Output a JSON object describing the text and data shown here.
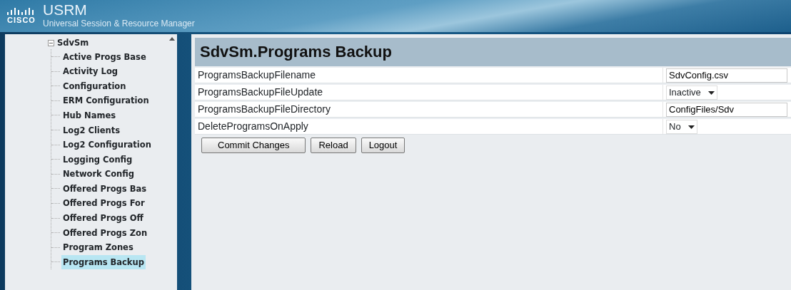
{
  "header": {
    "brand": "CISCO",
    "title": "USRM",
    "subtitle": "Universal Session & Resource Manager"
  },
  "sidebar": {
    "root": {
      "label": "SdvSm",
      "expanded": true,
      "children": [
        {
          "label": "Active Progs Base",
          "selected": false
        },
        {
          "label": "Activity Log",
          "selected": false
        },
        {
          "label": "Configuration",
          "selected": false
        },
        {
          "label": "ERM Configuration",
          "selected": false
        },
        {
          "label": "Hub Names",
          "selected": false
        },
        {
          "label": "Log2 Clients",
          "selected": false
        },
        {
          "label": "Log2 Configuration",
          "selected": false
        },
        {
          "label": "Logging Config",
          "selected": false
        },
        {
          "label": "Network Config",
          "selected": false
        },
        {
          "label": "Offered Progs Bas",
          "selected": false
        },
        {
          "label": "Offered Progs For",
          "selected": false
        },
        {
          "label": "Offered Progs Off",
          "selected": false
        },
        {
          "label": "Offered Progs Zon",
          "selected": false
        },
        {
          "label": "Program Zones",
          "selected": false
        },
        {
          "label": "Programs Backup",
          "selected": true
        }
      ]
    }
  },
  "panel": {
    "title": "SdvSm.Programs Backup",
    "fields": [
      {
        "label": "ProgramsBackupFilename",
        "kind": "text",
        "value": "SdvConfig.csv"
      },
      {
        "label": "ProgramsBackupFileUpdate",
        "kind": "select",
        "value": "Inactive"
      },
      {
        "label": "ProgramsBackupFileDirectory",
        "kind": "text",
        "value": "ConfigFiles/Sdv"
      },
      {
        "label": "DeleteProgramsOnApply",
        "kind": "select",
        "value": "No"
      }
    ],
    "buttons": [
      "Commit Changes",
      "Reload",
      "Logout"
    ]
  }
}
